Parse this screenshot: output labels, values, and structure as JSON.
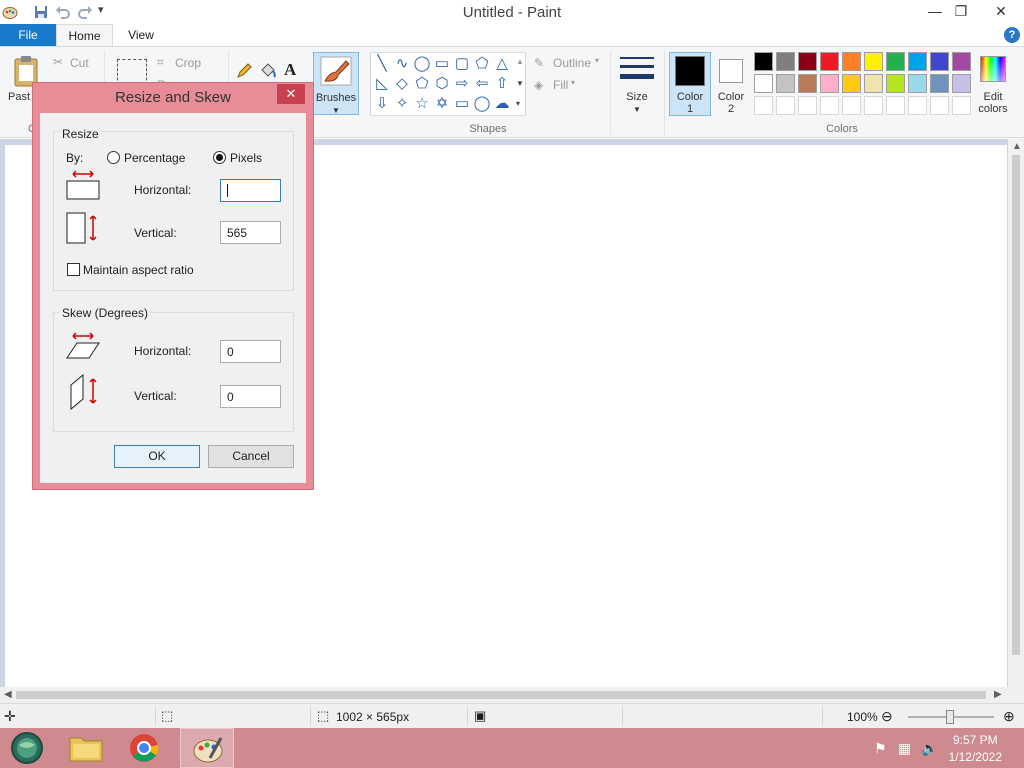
{
  "app": {
    "title": "Untitled - Paint"
  },
  "window_controls": {
    "minimize": "—",
    "restore": "❐",
    "close": "✕"
  },
  "tabs": [
    {
      "label": "File"
    },
    {
      "label": "Home"
    },
    {
      "label": "View"
    }
  ],
  "help_label": "?",
  "ribbon": {
    "clipboard": {
      "paste_label": "Past",
      "cut_label": "Cut",
      "group_label_fragment": "C"
    },
    "image": {
      "crop_label": "Crop",
      "resize_fragment": "Re"
    },
    "brushes_label": "Brushes",
    "shapes": {
      "outline_label": "Outline",
      "fill_label": "Fill",
      "group_label": "Shapes"
    },
    "size_label": "Size",
    "color1_label": "Color\n1",
    "color1_line1": "Color",
    "color1_line2": "1",
    "color2_line1": "Color",
    "color2_line2": "2",
    "colors_group_label": "Colors",
    "edit_colors_line1": "Edit",
    "edit_colors_line2": "colors",
    "palette_row1": [
      "#000000",
      "#7f7f7f",
      "#880015",
      "#ed1c24",
      "#ff7f27",
      "#fff200",
      "#22b14c",
      "#00a2e8",
      "#3f48cc",
      "#a349a4"
    ],
    "palette_row2": [
      "#ffffff",
      "#c3c3c3",
      "#b97a57",
      "#ffaec9",
      "#ffc90e",
      "#efe4b0",
      "#b5e61d",
      "#99d9ea",
      "#7092be",
      "#c8bfe7"
    ]
  },
  "dialog": {
    "title": "Resize and Skew",
    "close_label": "✕",
    "resize": {
      "group_title": "Resize",
      "by_label": "By:",
      "percentage_label": "Percentage",
      "pixels_label": "Pixels",
      "horizontal_label": "Horizontal:",
      "horizontal_value": "",
      "vertical_label": "Vertical:",
      "vertical_value": "565",
      "maintain_label": "Maintain aspect ratio"
    },
    "skew": {
      "group_title": "Skew (Degrees)",
      "horizontal_label": "Horizontal:",
      "horizontal_value": "0",
      "vertical_label": "Vertical:",
      "vertical_value": "0"
    },
    "ok_label": "OK",
    "cancel_label": "Cancel"
  },
  "statusbar": {
    "dimensions": "1002 × 565px",
    "zoom": "100%"
  },
  "taskbar": {
    "time": "9:57 PM",
    "date": "1/12/2022"
  }
}
